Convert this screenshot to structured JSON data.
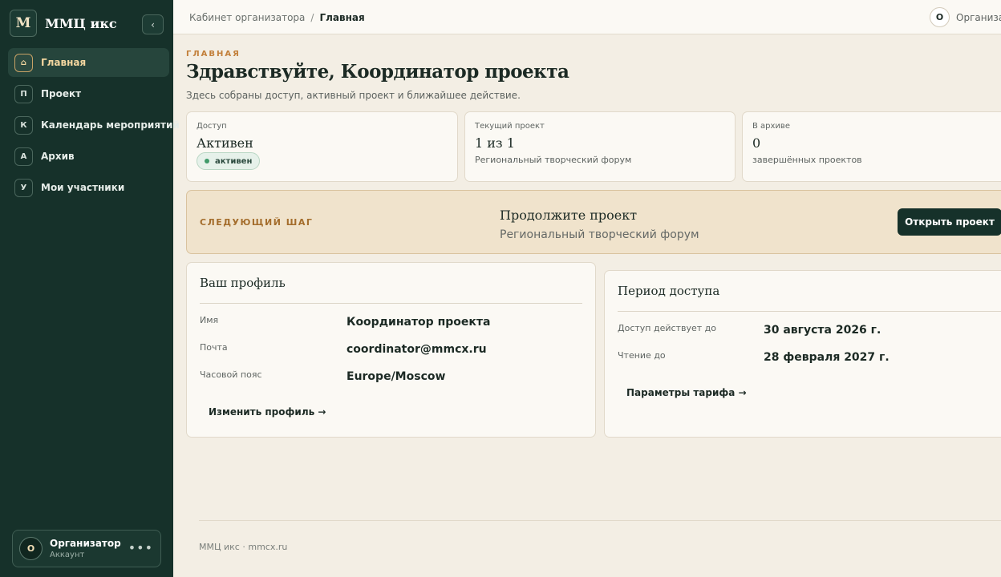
{
  "brand": {
    "logo_letter": "M",
    "name": "ММЦ икс",
    "collapse_icon": "‹"
  },
  "sidebar": {
    "items": [
      {
        "badge": "⌂",
        "label": "Главная",
        "active": true
      },
      {
        "badge": "П",
        "label": "Проект",
        "active": false
      },
      {
        "badge": "К",
        "label": "Календарь мероприятий",
        "active": false
      },
      {
        "badge": "А",
        "label": "Архив",
        "active": false
      },
      {
        "badge": "У",
        "label": "Мои участники",
        "active": false
      }
    ],
    "user": {
      "initial": "О",
      "name": "Организатор",
      "role": "Аккаунт",
      "more": "•••"
    }
  },
  "topbar": {
    "breadcrumb": {
      "root": "Кабинет организатора",
      "separator": "/",
      "current": "Главная"
    },
    "user": {
      "initial": "О",
      "name": "Организатор"
    }
  },
  "page": {
    "eyebrow": "ГЛАВНАЯ",
    "title": "Здравствуйте, Координатор проекта",
    "subtitle": "Здесь собраны доступ, активный проект и ближайшее действие."
  },
  "stats": {
    "access": {
      "label": "Доступ",
      "value": "Активен",
      "badge": "активен"
    },
    "current_project": {
      "label": "Текущий проект",
      "value": "1 из 1",
      "note": "Региональный творческий форум"
    },
    "archive": {
      "label": "В архиве",
      "value": "0",
      "note": "завершённых проектов"
    }
  },
  "next_step": {
    "label": "СЛЕДУЮЩИЙ ШАГ",
    "title": "Продолжите проект",
    "subtitle": "Региональный творческий форум",
    "button": "Открыть проект"
  },
  "profile": {
    "title": "Ваш профиль",
    "rows": [
      {
        "label": "Имя",
        "value": "Координатор проекта"
      },
      {
        "label": "Почта",
        "value": "coordinator@mmcx.ru"
      },
      {
        "label": "Часовой пояс",
        "value": "Europe/Moscow"
      }
    ],
    "link": "Изменить профиль →"
  },
  "access_period": {
    "title": "Период доступа",
    "rows": [
      {
        "label": "Доступ действует до",
        "value": "30 августа 2026 г."
      },
      {
        "label": "Чтение до",
        "value": "28 февраля 2027 г."
      }
    ],
    "link": "Параметры тарифа →"
  },
  "footer": {
    "text": "ММЦ икс · mmcx.ru"
  },
  "colors": {
    "sidebar_bg": "#16312a",
    "accent": "#c27f3a",
    "active_text": "#f4d7a0",
    "page_bg": "#f3eee4",
    "success": "#3f9a69"
  }
}
